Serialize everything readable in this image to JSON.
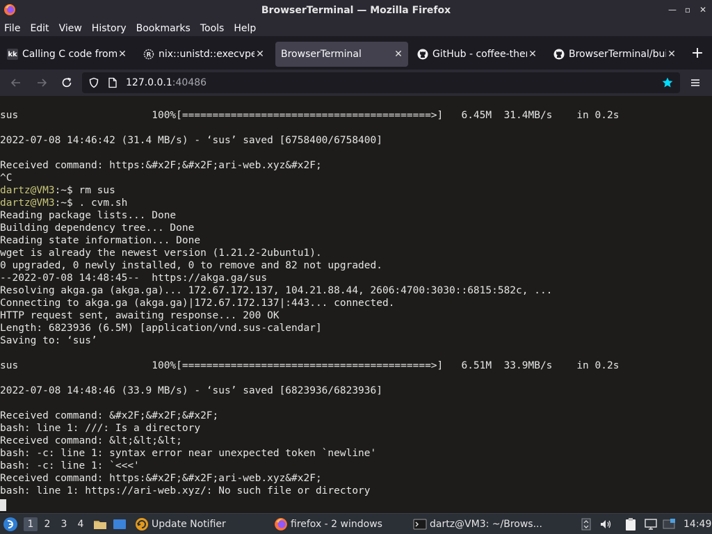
{
  "window": {
    "title": "BrowserTerminal — Mozilla Firefox"
  },
  "menu": [
    "File",
    "Edit",
    "View",
    "History",
    "Bookmarks",
    "Tools",
    "Help"
  ],
  "tabs": [
    {
      "label": "Calling C code from",
      "icon": "kk-favicon-icon",
      "active": false
    },
    {
      "label": "nix::unistd::execvpe",
      "icon": "rust-icon",
      "active": false
    },
    {
      "label": "BrowserTerminal",
      "icon": "",
      "active": true
    },
    {
      "label": "GitHub - coffee-them",
      "icon": "github-icon",
      "active": false
    },
    {
      "label": "BrowserTerminal/buil",
      "icon": "github-icon",
      "active": false
    }
  ],
  "url": {
    "host": "127.0.0.1",
    "port": ":40486"
  },
  "terminal": {
    "lines": [
      "sus                      100%[=========================================>]   6.45M  31.4MB/s    in 0.2s",
      "",
      "2022-07-08 14:46:42 (31.4 MB/s) - ‘sus’ saved [6758400/6758400]",
      "",
      "Received command: https:&#x2F;&#x2F;ari-web.xyz&#x2F;",
      "^C",
      "dartz@VM3:~$ rm sus",
      "dartz@VM3:~$ . cvm.sh",
      "Reading package lists... Done",
      "Building dependency tree... Done",
      "Reading state information... Done",
      "wget is already the newest version (1.21.2-2ubuntu1).",
      "0 upgraded, 0 newly installed, 0 to remove and 82 not upgraded.",
      "--2022-07-08 14:48:45--  https://akga.ga/sus",
      "Resolving akga.ga (akga.ga)... 172.67.172.137, 104.21.88.44, 2606:4700:3030::6815:582c, ...",
      "Connecting to akga.ga (akga.ga)|172.67.172.137|:443... connected.",
      "HTTP request sent, awaiting response... 200 OK",
      "Length: 6823936 (6.5M) [application/vnd.sus-calendar]",
      "Saving to: ‘sus’",
      "",
      "sus                      100%[=========================================>]   6.51M  33.9MB/s    in 0.2s",
      "",
      "2022-07-08 14:48:46 (33.9 MB/s) - ‘sus’ saved [6823936/6823936]",
      "",
      "Received command: &#x2F;&#x2F;&#x2F;",
      "bash: line 1: ///: Is a directory",
      "Received command: &lt;&lt;&lt;",
      "bash: -c: line 1: syntax error near unexpected token `newline'",
      "bash: -c: line 1: `<<<'",
      "Received command: https:&#x2F;&#x2F;ari-web.xyz&#x2F;",
      "bash: line 1: https://ari-web.xyz/: No such file or directory"
    ],
    "prompt": "dartz@VM3",
    "prompt_lines": [
      6,
      7
    ]
  },
  "taskbar": {
    "workspaces": [
      "1",
      "2",
      "3",
      "4"
    ],
    "active_workspace": "1",
    "apps": [
      {
        "label": "Update Notifier",
        "icon": "update-notifier-icon"
      },
      {
        "label": "firefox - 2 windows",
        "icon": "firefox-icon"
      },
      {
        "label": "dartz@VM3: ~/Brows...",
        "icon": "terminal-icon"
      }
    ],
    "clock": "14:49"
  },
  "colors": {
    "accent": "#00ddff",
    "prompt": "#c8c67a",
    "terminal_bg": "#1d1c1a",
    "chrome_bg": "#2b2a33"
  }
}
